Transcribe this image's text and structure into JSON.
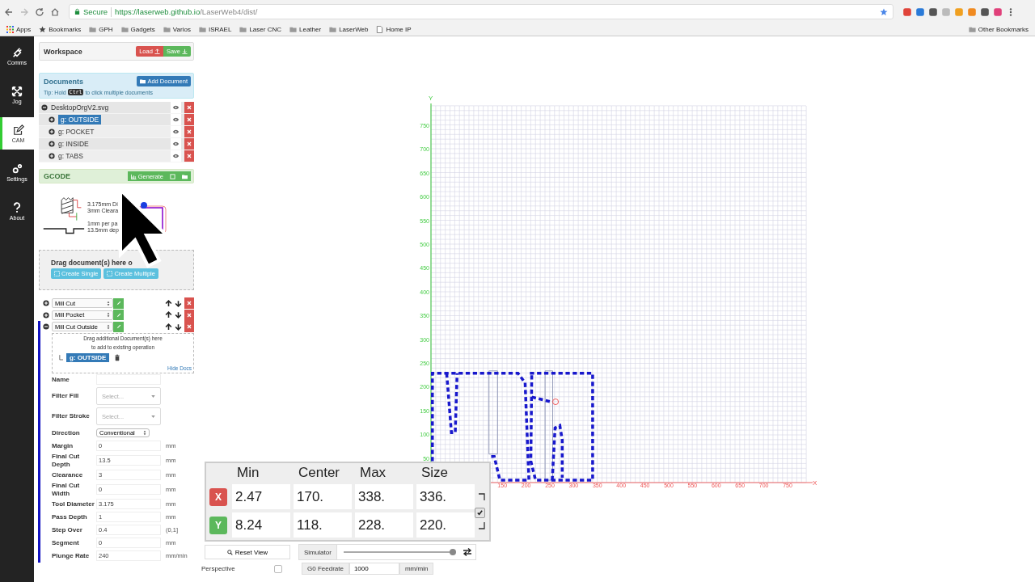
{
  "browser": {
    "secure_label": "Secure",
    "url_host": "https://laserweb.github.io",
    "url_path": "/LaserWeb4/dist/",
    "bookmarks": [
      {
        "label": "Apps",
        "kind": "apps"
      },
      {
        "label": "Bookmarks",
        "kind": "star"
      },
      {
        "label": "GPH",
        "kind": "folder"
      },
      {
        "label": "Gadgets",
        "kind": "folder"
      },
      {
        "label": "Varios",
        "kind": "folder"
      },
      {
        "label": "ISRAEL",
        "kind": "folder"
      },
      {
        "label": "Laser CNC",
        "kind": "folder"
      },
      {
        "label": "Leather",
        "kind": "folder"
      },
      {
        "label": "LaserWeb",
        "kind": "folder"
      },
      {
        "label": "Home IP",
        "kind": "page"
      }
    ],
    "other_bookmarks": "Other Bookmarks"
  },
  "nav": [
    {
      "label": "Comms",
      "kind": "plug",
      "selected": false
    },
    {
      "label": "Jog",
      "kind": "move",
      "selected": false
    },
    {
      "label": "CAM",
      "kind": "edit",
      "selected": true
    },
    {
      "label": "Settings",
      "kind": "gears",
      "selected": false
    },
    {
      "label": "About",
      "kind": "help",
      "selected": false
    }
  ],
  "workspace": {
    "title": "Workspace",
    "buttons": [
      {
        "label": "Load",
        "kind": "load"
      },
      {
        "label": "Save",
        "kind": "save"
      }
    ]
  },
  "documents": {
    "title": "Documents",
    "add_button": "Add Document",
    "tip_before": "Tip: Hold",
    "tip_key": "Ctrl",
    "tip_after": "to click multiple documents",
    "tree": [
      {
        "label": "DesktopOrgV2.svg",
        "expanded": true,
        "selected": false,
        "children": [
          {
            "label": "g: OUTSIDE",
            "expanded": false,
            "selected": true
          },
          {
            "label": "g: POCKET",
            "expanded": false,
            "selected": false
          },
          {
            "label": "g: INSIDE",
            "expanded": false,
            "selected": false
          },
          {
            "label": "g: TABS",
            "expanded": false,
            "selected": false
          }
        ]
      }
    ]
  },
  "gcode": {
    "title": "GCODE",
    "generate_button": "Generate"
  },
  "tool_diagram": {
    "labels": [
      "3.175mm Di",
      "3mm Cleara",
      "1mm per pa",
      "13.5mm dep"
    ]
  },
  "drop_zone": {
    "text": "Drag document(s) here o",
    "buttons": [
      "Create Single",
      "Create Multiple"
    ]
  },
  "operations": [
    {
      "name": "Mill Cut",
      "expanded": false
    },
    {
      "name": "Mill Pocket",
      "expanded": false
    },
    {
      "name": "Mill Cut Outside",
      "expanded": true,
      "docs_hint": [
        "Drag additional Document(s) here",
        "to add to existing operation"
      ],
      "docs": [
        "g: OUTSIDE"
      ],
      "hide_docs": "Hide Docs",
      "fields": [
        {
          "label": "Name",
          "kind": "text"
        },
        {
          "label": "Filter Fill",
          "kind": "select",
          "placeholder": "Select..."
        },
        {
          "label": "Filter Stroke",
          "kind": "select",
          "placeholder": "Select..."
        },
        {
          "label": "Direction",
          "kind": "dropdown",
          "value": "Conventional"
        },
        {
          "label": "Margin",
          "kind": "text",
          "value": "0",
          "unit": "mm"
        },
        {
          "label": "Final Cut Depth",
          "kind": "text",
          "value": "13.5",
          "unit": "mm"
        },
        {
          "label": "Clearance",
          "kind": "text",
          "value": "3",
          "unit": "mm"
        },
        {
          "label": "Final Cut Width",
          "kind": "text",
          "value": "0",
          "unit": "mm"
        },
        {
          "label": "Tool Diameter",
          "kind": "text",
          "value": "3.175",
          "unit": "mm"
        },
        {
          "label": "Pass Depth",
          "kind": "text",
          "value": "1",
          "unit": "mm"
        },
        {
          "label": "Step Over",
          "kind": "text",
          "value": "0.4",
          "unit": "(0,1]"
        },
        {
          "label": "Segment",
          "kind": "text",
          "value": "0",
          "unit": "mm"
        },
        {
          "label": "Plunge Rate",
          "kind": "text",
          "value": "240",
          "unit": "mm/min"
        }
      ]
    }
  ],
  "canvas": {
    "y_axis": "Y",
    "x_axis": "X",
    "yticks": [
      "750",
      "700",
      "650",
      "600",
      "550",
      "500",
      "450",
      "400",
      "350",
      "300",
      "250",
      "200",
      "150",
      "100",
      "50"
    ],
    "xticks": [
      "150",
      "200",
      "250",
      "300",
      "350",
      "400",
      "450",
      "500",
      "550",
      "600",
      "650",
      "700",
      "750"
    ]
  },
  "bounds": {
    "columns": [
      "Min",
      "Center",
      "Max",
      "Size"
    ],
    "linked": true,
    "rows": [
      {
        "axis": "X",
        "values": [
          "2.47",
          "170.",
          "338.",
          "336."
        ]
      },
      {
        "axis": "Y",
        "values": [
          "8.24",
          "118.",
          "228.",
          "220."
        ]
      }
    ]
  },
  "controls": {
    "reset_view": "Reset View",
    "simulator": {
      "label": "Simulator",
      "level": 1
    },
    "perspective": {
      "label": "Perspective",
      "checked": false
    },
    "g0": {
      "label": "G0 Feedrate",
      "value": "1000",
      "unit": "mm/min"
    }
  }
}
